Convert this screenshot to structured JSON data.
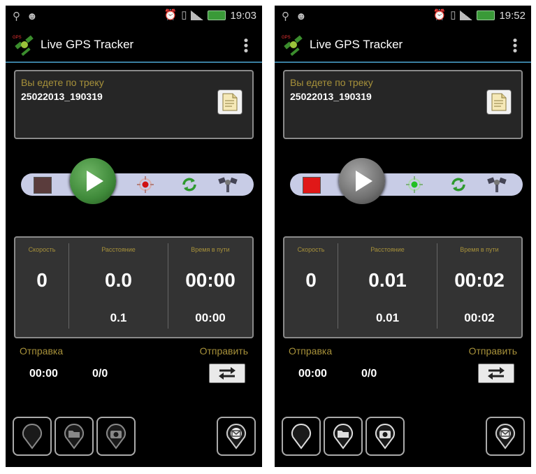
{
  "app": {
    "title": "Live GPS Tracker"
  },
  "screens": [
    {
      "status_time": "19:03",
      "track": {
        "label": "Вы едете по треку",
        "name": "25022013_190319"
      },
      "stats": {
        "speed": {
          "label": "Скорость",
          "value": "0"
        },
        "distance": {
          "label": "Расстояние",
          "value": "0.0",
          "sub": "0.1"
        },
        "time": {
          "label": "Время в пути",
          "value": "00:00",
          "sub": "00:00"
        }
      },
      "send": {
        "title": "Отправка",
        "action": "Отправить",
        "time": "00:00",
        "count": "0/0"
      },
      "state": {
        "play_color": "#3f8a3a",
        "stop_color": "#5a3c3c",
        "target_color": "#d01010"
      }
    },
    {
      "status_time": "19:52",
      "track": {
        "label": "Вы едете по треку",
        "name": "25022013_190319"
      },
      "stats": {
        "speed": {
          "label": "Скорость",
          "value": "0"
        },
        "distance": {
          "label": "Расстояние",
          "value": "0.01",
          "sub": "0.01"
        },
        "time": {
          "label": "Время в пути",
          "value": "00:02",
          "sub": "00:02"
        }
      },
      "send": {
        "title": "Отправка",
        "action": "Отправить",
        "time": "00:00",
        "count": "0/0"
      },
      "state": {
        "play_color": "#707070",
        "stop_color": "#e01818",
        "target_color": "#22c022"
      }
    }
  ],
  "icons": {
    "status_left": [
      "usb-icon",
      "android-icon"
    ],
    "status_right": [
      "alarm-icon",
      "vibrate-icon",
      "signal-icon",
      "battery-icon"
    ],
    "logo": "satellite-logo-icon",
    "menu": "overflow-menu-icon",
    "doc": "document-icon",
    "controls": [
      "stop-icon",
      "play-icon",
      "gps-target-icon",
      "sync-icon",
      "satellite-icon"
    ],
    "send": "swap-arrows-icon",
    "bottom": [
      "map-pin-icon",
      "folder-pin-icon",
      "camera-pin-icon",
      "message-pin-icon"
    ]
  }
}
